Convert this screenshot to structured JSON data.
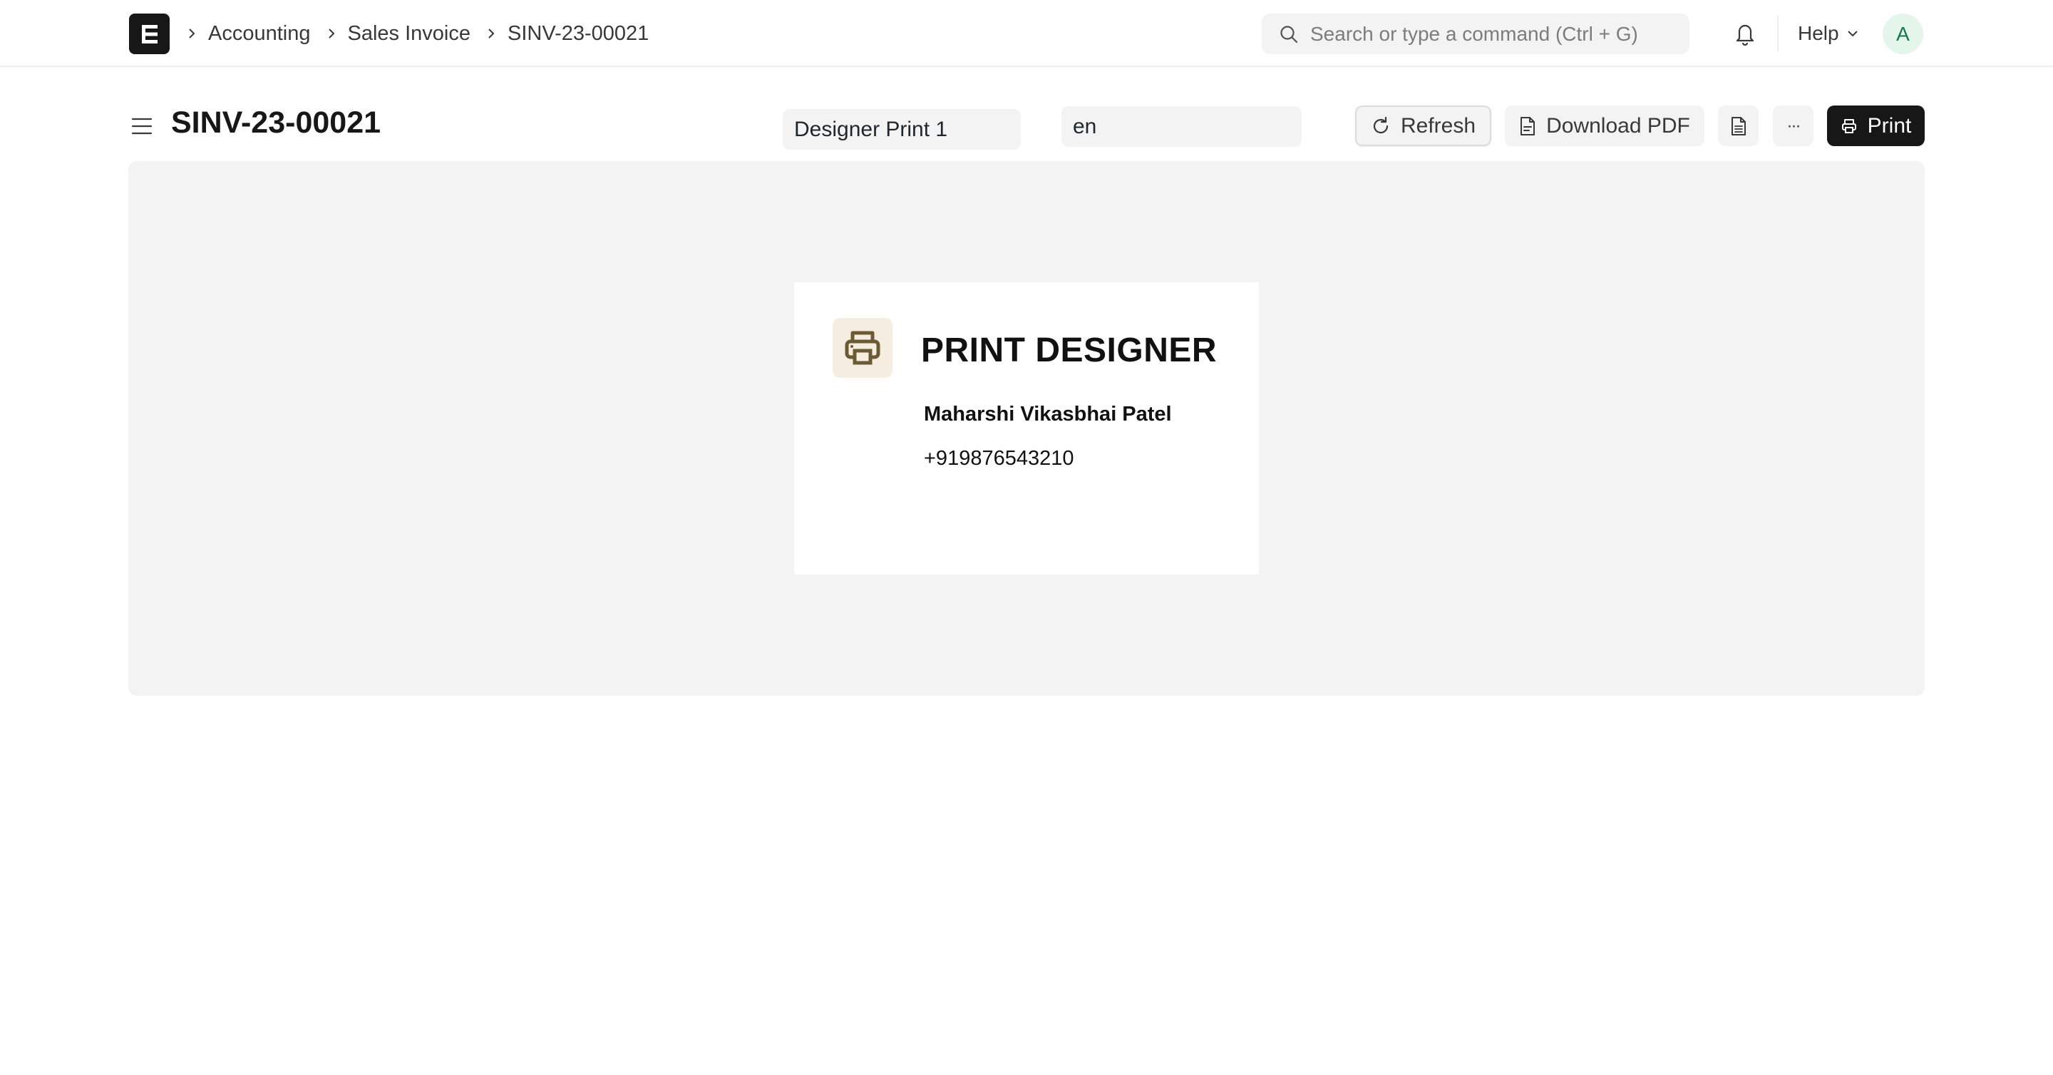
{
  "navbar": {
    "breadcrumb": [
      "Accounting",
      "Sales Invoice",
      "SINV-23-00021"
    ],
    "search": {
      "placeholder": "Search or type a command (Ctrl + G)",
      "value": ""
    },
    "help_label": "Help",
    "avatar_initial": "A"
  },
  "page": {
    "title": "SINV-23-00021",
    "print_format": "Designer Print 1",
    "language": "en",
    "buttons": {
      "refresh": "Refresh",
      "download_pdf": "Download PDF",
      "more": "···",
      "print": "Print"
    }
  },
  "preview": {
    "title": "PRINT DESIGNER",
    "name": "Maharshi Vikasbhai Patel",
    "phone": "+919876543210"
  },
  "colors": {
    "primary_button": "#171717",
    "preview_background": "#f3f3f3",
    "avatar_bg": "#e4f5e9",
    "avatar_text": "#16794c",
    "logo_icon": "#6b5a35",
    "logo_bg": "#f5eee0"
  }
}
